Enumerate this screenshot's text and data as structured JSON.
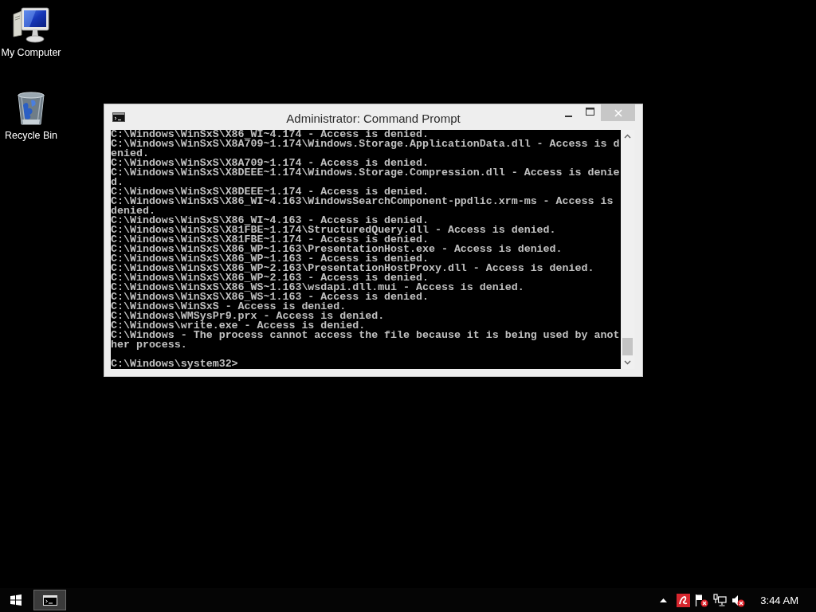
{
  "desktop_icons": [
    {
      "kind": "computer",
      "label": "My Computer"
    },
    {
      "kind": "recycle-bin",
      "label": "Recycle Bin"
    }
  ],
  "window": {
    "title": "Administrator: Command Prompt",
    "lines": [
      "C:\\Windows\\WinSxS\\X86_WI~4.174 - Access is denied.",
      "C:\\Windows\\WinSxS\\X8A709~1.174\\Windows.Storage.ApplicationData.dll - Access is d",
      "enied.",
      "C:\\Windows\\WinSxS\\X8A709~1.174 - Access is denied.",
      "C:\\Windows\\WinSxS\\X8DEEE~1.174\\Windows.Storage.Compression.dll - Access is denie",
      "d.",
      "C:\\Windows\\WinSxS\\X8DEEE~1.174 - Access is denied.",
      "C:\\Windows\\WinSxS\\X86_WI~4.163\\WindowsSearchComponent-ppdlic.xrm-ms - Access is",
      "denied.",
      "C:\\Windows\\WinSxS\\X86_WI~4.163 - Access is denied.",
      "C:\\Windows\\WinSxS\\X81FBE~1.174\\StructuredQuery.dll - Access is denied.",
      "C:\\Windows\\WinSxS\\X81FBE~1.174 - Access is denied.",
      "C:\\Windows\\WinSxS\\X86_WP~1.163\\PresentationHost.exe - Access is denied.",
      "C:\\Windows\\WinSxS\\X86_WP~1.163 - Access is denied.",
      "C:\\Windows\\WinSxS\\X86_WP~2.163\\PresentationHostProxy.dll - Access is denied.",
      "C:\\Windows\\WinSxS\\X86_WP~2.163 - Access is denied.",
      "C:\\Windows\\WinSxS\\X86_WS~1.163\\wsdapi.dll.mui - Access is denied.",
      "C:\\Windows\\WinSxS\\X86_WS~1.163 - Access is denied.",
      "C:\\Windows\\WinSxS - Access is denied.",
      "C:\\Windows\\WMSysPr9.prx - Access is denied.",
      "C:\\Windows\\write.exe - Access is denied.",
      "C:\\Windows - The process cannot access the file because it is being used by anot",
      "her process."
    ],
    "prompt": "C:\\Windows\\system32>"
  },
  "taskbar": {
    "buttons": [
      {
        "kind": "console",
        "selected": true
      }
    ],
    "clock": "3:44 AM"
  }
}
